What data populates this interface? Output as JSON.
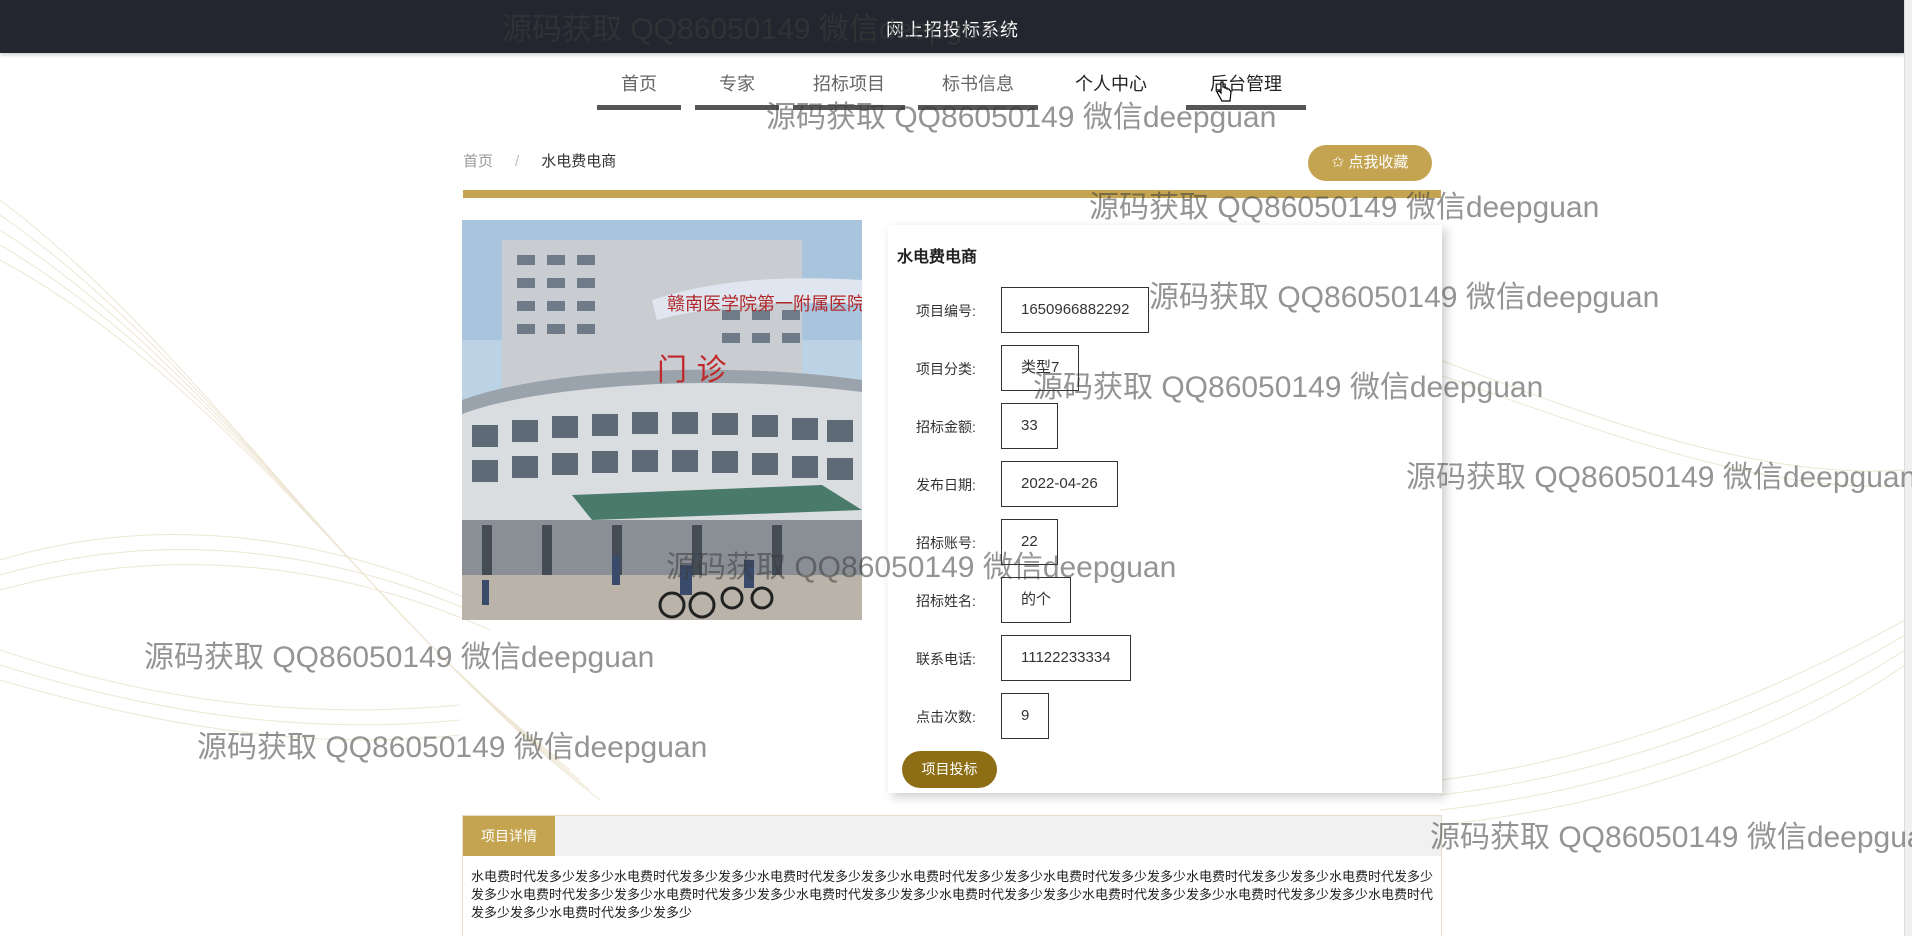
{
  "app": {
    "title": "网上招投标系统"
  },
  "nav": {
    "items": [
      {
        "label": "首页"
      },
      {
        "label": "专家"
      },
      {
        "label": "招标项目"
      },
      {
        "label": "标书信息"
      },
      {
        "label": "个人中心"
      },
      {
        "label": "后台管理"
      }
    ]
  },
  "breadcrumb": {
    "home": "首页",
    "sep": "/",
    "current": "水电费电商"
  },
  "favorite": {
    "label": "✩ 点我收藏"
  },
  "project": {
    "title": "水电费电商",
    "fields": [
      {
        "label": "项目编号:",
        "value": "1650966882292"
      },
      {
        "label": "项目分类:",
        "value": "类型7"
      },
      {
        "label": "招标金额:",
        "value": "33"
      },
      {
        "label": "发布日期:",
        "value": "2022-04-26"
      },
      {
        "label": "招标账号:",
        "value": "22"
      },
      {
        "label": "招标姓名:",
        "value": "的个"
      },
      {
        "label": "联系电话:",
        "value": "11122233334"
      },
      {
        "label": "点击次数:",
        "value": "9"
      }
    ],
    "bid_button": "项目投标"
  },
  "detail": {
    "tab": "项目详情",
    "text": "水电费时代发多少发多少水电费时代发多少发多少水电费时代发多少发多少水电费时代发多少发多少水电费时代发多少发多少水电费时代发多少发多少水电费时代发多少发多少水电费时代发多少发多少水电费时代发多少发多少水电费时代发多少发多少水电费时代发多少发多少水电费时代发多少发多少水电费时代发多少发多少水电费时代发多少发多少水电费时代发多少发多少"
  },
  "watermark": {
    "text": "源码获取 QQ86050149 微信deepguan"
  },
  "colors": {
    "gold": "#c4a450",
    "dark_gold": "#8d6e14",
    "header": "#23262e"
  }
}
